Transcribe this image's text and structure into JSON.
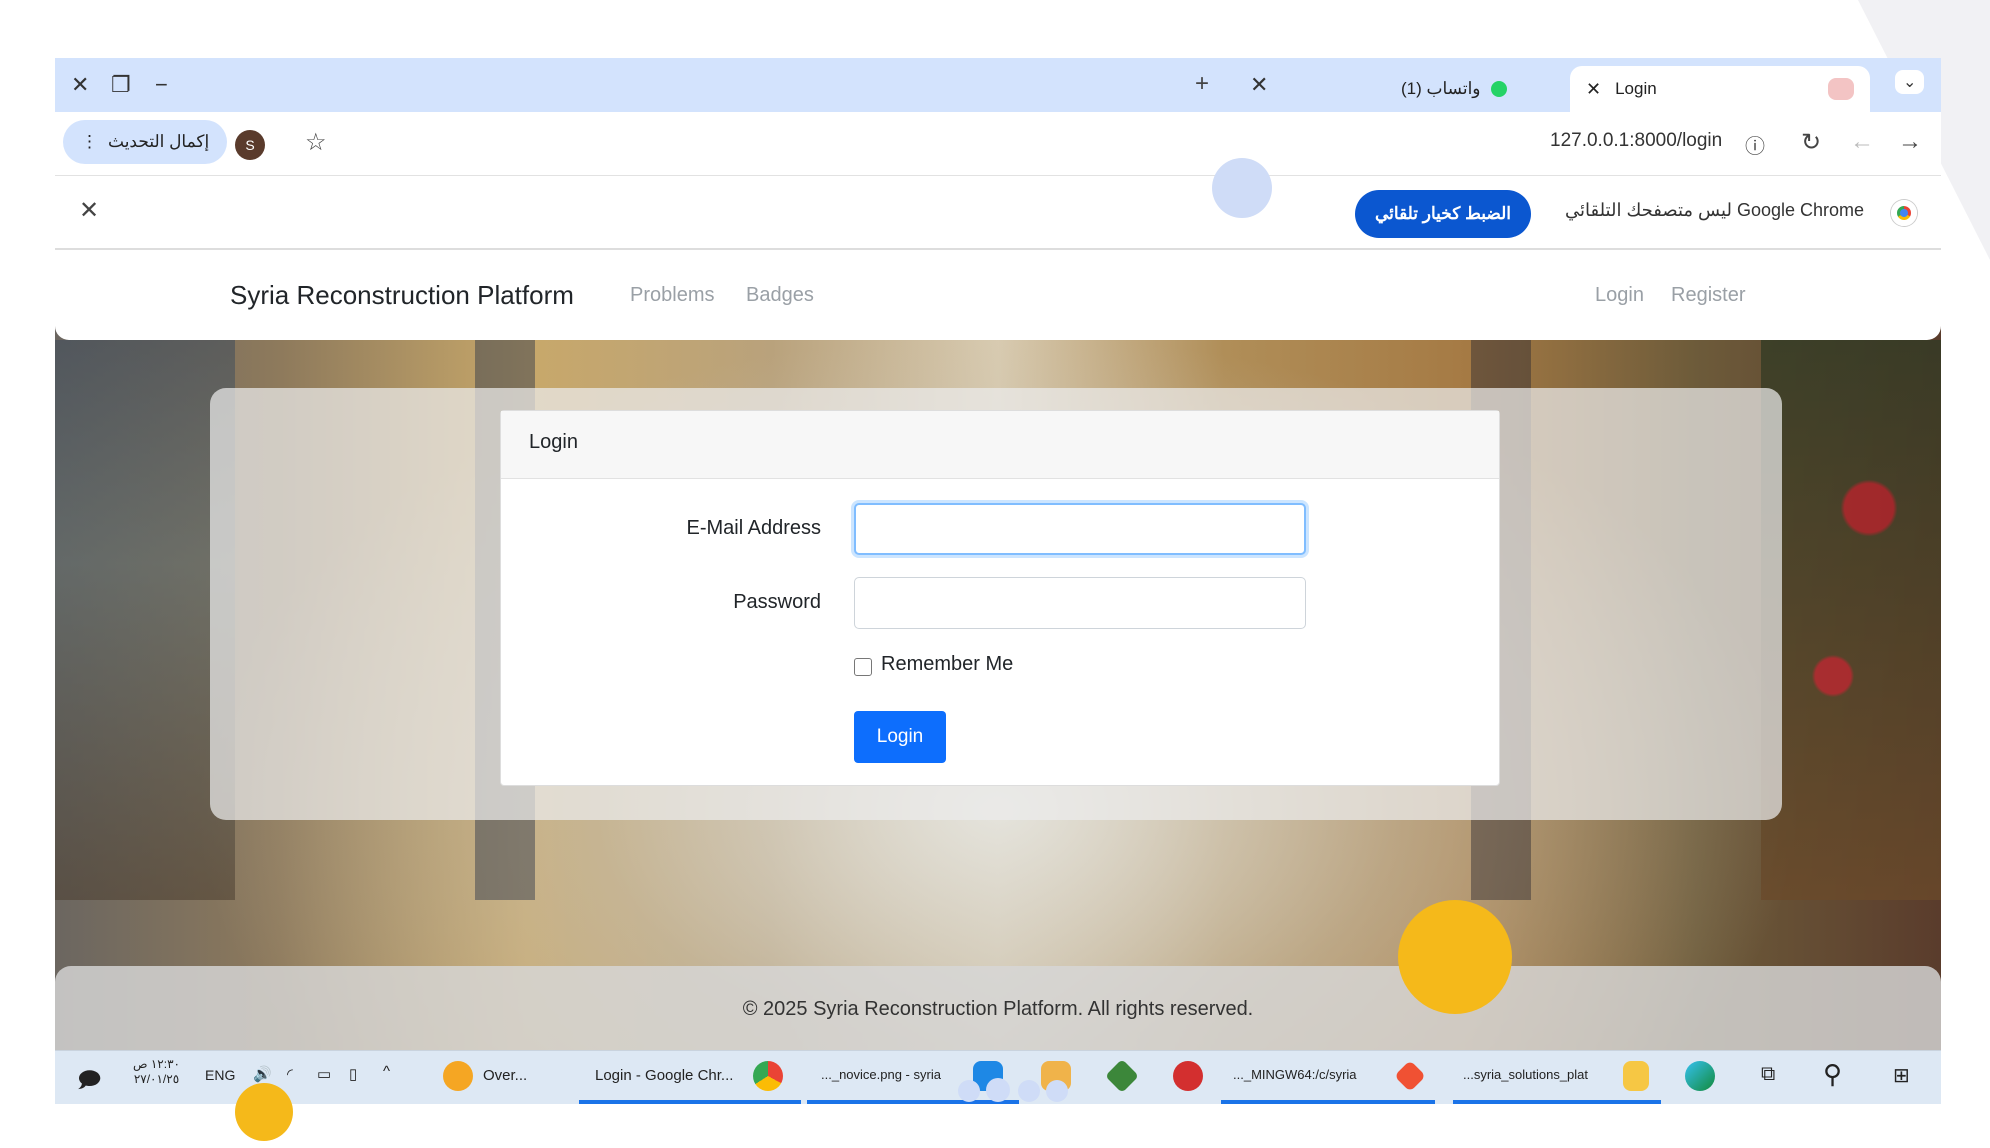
{
  "browser": {
    "tabs": [
      {
        "title": "Login",
        "active": true
      },
      {
        "title": "(1) واتساب",
        "active": false
      }
    ],
    "new_tab_symbol": "+",
    "address": "127.0.0.1:8000/login",
    "update_button": "إكمال التحديث",
    "profile_initial": "S",
    "infobar": {
      "message": "Google Chrome ليس متصفحك التلقائي",
      "button": "الضبط كخيار تلقائي"
    }
  },
  "site": {
    "brand": "Syria Reconstruction Platform",
    "nav_left": [
      "Problems",
      "Badges"
    ],
    "nav_right": [
      "Login",
      "Register"
    ],
    "card_title": "Login",
    "email_label": "E-Mail Address",
    "email_value": "",
    "password_label": "Password",
    "password_value": "",
    "remember_label": "Remember Me",
    "remember_checked": false,
    "submit_label": "Login",
    "footer": "© 2025 Syria Reconstruction Platform. All rights reserved."
  },
  "taskbar": {
    "time": "١٢:٣٠ ص",
    "date": "٢٧/٠١/٢٥",
    "language": "ENG",
    "apps": [
      {
        "label": "Over...",
        "icon": "chat-app-icon"
      },
      {
        "label": "Login - Google Chr...",
        "icon": "chrome-icon"
      },
      {
        "label": "..._novice.png - syria",
        "icon": "vscode-icon"
      },
      {
        "label": "",
        "icon": "paint-icon"
      },
      {
        "label": "",
        "icon": "node-icon"
      },
      {
        "label": "",
        "icon": "postman-icon"
      },
      {
        "label": "..._MINGW64:/c/syria",
        "icon": "git-bash-icon"
      },
      {
        "label": "...syria_solutions_plat",
        "icon": "folder-icon"
      },
      {
        "label": "",
        "icon": "edge-icon"
      }
    ]
  },
  "colors": {
    "primary": "#0d6efd",
    "tabbar": "#d3e3fd",
    "chrome_button": "#0b57d0",
    "highlight_yellow": "#f5b91a",
    "highlight_blue": "#cfdcf7"
  }
}
